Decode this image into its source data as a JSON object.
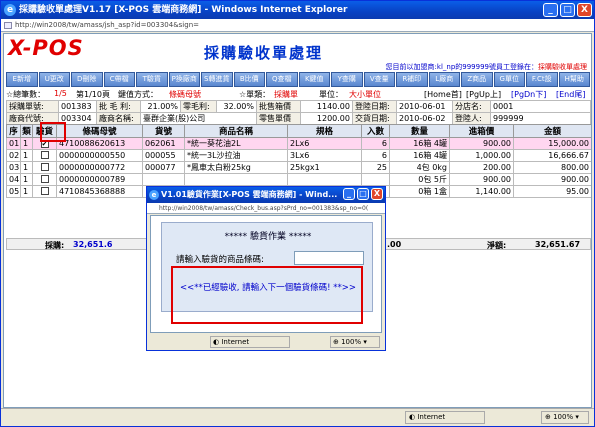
{
  "window": {
    "title": "採購驗收單處理V1.17 [X-POS 雲端商務網] - Windows Internet Explorer",
    "address": "http://win2008/tw/amass/jsh_asp?id=003304&sign=",
    "controls": {
      "minimize": "_",
      "maximize": "□",
      "close": "X"
    }
  },
  "header": {
    "logo": "X-POS",
    "page_title": "採購驗收單處理",
    "user_prefix": "您目前以加盟商:kl_np的999999號員工登錄在：",
    "user_location": "採購驗收單處理"
  },
  "toolbar": [
    "E新增",
    "U更改",
    "D刪除",
    "C帶檔",
    "T驗貨",
    "P換廠商",
    "S轉進貨",
    "B比價",
    "Q查檔",
    "K鍵值",
    "Y查購",
    "V查量",
    "R補印",
    "L廠商",
    "Z商品",
    "G單位",
    "F.Ct設",
    "H幫助"
  ],
  "nav": {
    "total_label": "☆總筆數：",
    "total_value": "1/5",
    "page_label": "第1/10頁",
    "key_label": "鍵值方式：",
    "key_value": "條碼母號",
    "type_label": "☆單類：",
    "type_value": "採購單",
    "unit_label": "單位：",
    "unit_value": "大小單位",
    "home": "[Home首]",
    "pgup": "[PgUp上]",
    "pgdn": "[PgDn下]",
    "end": "[End尾]"
  },
  "form": {
    "row1": {
      "order_label": "採購單號:",
      "order_value": "001383",
      "gp_label": "批 毛 利:",
      "gp_value": "21.00%",
      "zgp_label": "零毛利:",
      "zgp_value": "32.00%",
      "total_label": "批售箱價",
      "total_value": "1140.00",
      "reg_label": "登陸日期:",
      "reg_value": "2010-06-01",
      "branch_label": "分店名:",
      "branch_value": "0001"
    },
    "row2": {
      "vendor_label": "廠商代號:",
      "vendor_value": "003304",
      "vname_label": "廠商名稱:",
      "vname_value": "臺群企業(股)公司",
      "retail_label": "零售單價",
      "retail_value": "1200.00",
      "deliv_label": "交貨日期:",
      "deliv_value": "2010-06-02",
      "login_label": "登陸人:",
      "login_value": "999999"
    }
  },
  "table": {
    "headers": [
      "序",
      "類",
      "驗貨",
      "條碼母號",
      "貨號",
      "商品名稱",
      "規格",
      "入數",
      "數量",
      "進箱價",
      "金額"
    ],
    "rows": [
      [
        "01",
        "1",
        "✔",
        "4710088620613",
        "062061",
        "*統一葵花油2L",
        "2Lx6",
        "6",
        "16箱  4罐",
        "900.00",
        "15,000.00"
      ],
      [
        "02",
        "1",
        "",
        "0000000000550",
        "000055",
        "*統一3L沙拉油",
        "3Lx6",
        "6",
        "16箱  4罐",
        "1,000.00",
        "16,666.67"
      ],
      [
        "03",
        "1",
        "",
        "0000000000772",
        "000077",
        "*鳳車太白粉25kg",
        "25kgx1",
        "25",
        "4包  0kg",
        "200.00",
        "800.00"
      ],
      [
        "04",
        "1",
        "",
        "0000000000789",
        "",
        "",
        "",
        "",
        "0包  5斤",
        "900.00",
        "900.00"
      ],
      [
        "05",
        "1",
        "",
        "4710845368888",
        "",
        "",
        "",
        "",
        "0箱  1盒",
        "1,140.00",
        "95.00"
      ]
    ]
  },
  "totals": {
    "purchase_label": "採購:",
    "purchase_value": "32,651.6",
    "mid_value": ".00",
    "net_label": "淨額:",
    "net_value": "32,651.67"
  },
  "statusbar": {
    "zone": "Internet",
    "zoom": "100%"
  },
  "dialog": {
    "title": "V1.01驗貨作業[X-POS 雲端商務網] - Wind...",
    "address": "http://win2008/tw/amass/Check_bus.asp?sPrd_no=001383&sp_no=0(",
    "heading": "***** 驗貨作業 *****",
    "prompt": "請輸入驗貨的商品條碼:",
    "input_value": "",
    "message": "<<**已經驗收, 請輸入下一個驗貨條碼! **>>",
    "status_zone": "Internet",
    "status_zoom": "100%"
  },
  "colors": {
    "accent": "#0831d9",
    "highlight": "#e00000",
    "selected_row": "#ffd6f0"
  }
}
